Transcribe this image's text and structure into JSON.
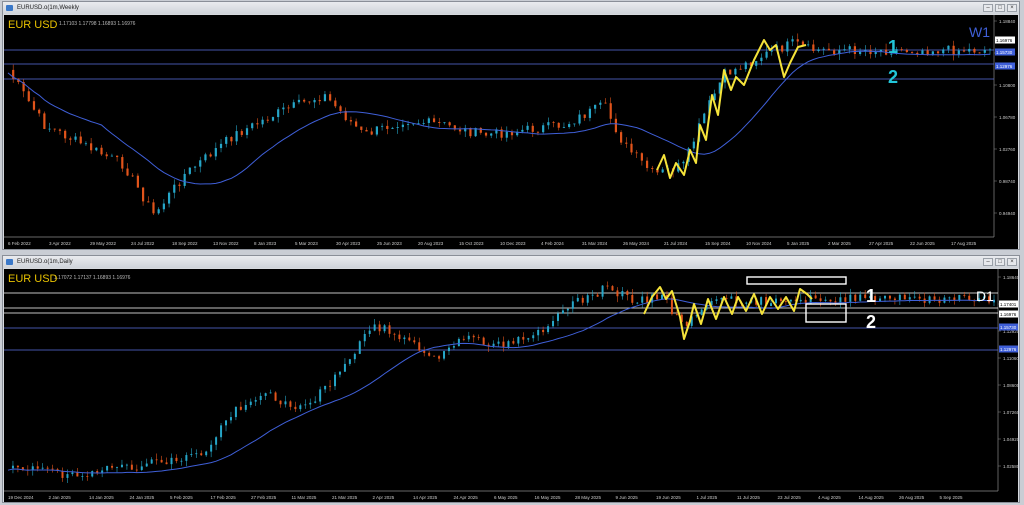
{
  "charts": [
    {
      "window_title": "EURUSD.o(1m,Weekly",
      "ohlc": "1.17103 1.17798 1.16893 1.16976",
      "symbol_label": "EUR USD",
      "timeframe": "W1",
      "marker_1": "1",
      "marker_2": "2",
      "price_ticks": [
        "1.18840",
        "1.14820",
        "1.10800",
        "1.06780",
        "1.02760",
        "0.98740",
        "0.94940"
      ],
      "price_boxes": [
        "1.16976",
        "1.15730",
        "1.12976"
      ],
      "date_ticks": [
        "6 Feb 2022",
        "3 Apr 2022",
        "29 May 2022",
        "24 Jul 2022",
        "18 Sep 2022",
        "13 Nov 2022",
        "8 Jan 2023",
        "5 Mar 2023",
        "30 Apr 2023",
        "25 Jun 2023",
        "20 Aug 2023",
        "15 Oct 2023",
        "10 Dec 2023",
        "4 Feb 2024",
        "31 Mar 2024",
        "26 May 2024",
        "21 Jul 2024",
        "15 Sep 2024",
        "10 Nov 2024",
        "5 Jan 2025",
        "2 Mar 2025",
        "27 Apr 2025",
        "22 Jun 2025",
        "17 Aug 2025"
      ],
      "colors": {
        "bull": "#26a6c8",
        "bear": "#e1541b",
        "ma": "#3f5fd8",
        "pattern": "#f5e33a",
        "hline": "#5b6fe0",
        "label": "#e8c200",
        "markers": "#22c6d9"
      }
    },
    {
      "window_title": "EURUSD.o(1m,Daily",
      "ohlc": "1.17072 1.17137 1.16893 1.16976",
      "symbol_label": "EUR USD",
      "timeframe": "D1",
      "marker_1": "1",
      "marker_2": "2",
      "price_ticks": [
        "1.18640",
        "1.15060",
        "1.12920",
        "1.11060",
        "1.08600",
        "1.07260",
        "1.04920",
        "1.02580"
      ],
      "price_boxes": [
        "1.17401",
        "1.16976",
        "1.15730",
        "1.12976"
      ],
      "date_ticks": [
        "19 Dec 2024",
        "2 Jan 2025",
        "14 Jan 2025",
        "24 Jan 2025",
        "5 Feb 2025",
        "17 Feb 2025",
        "27 Feb 2025",
        "11 Mar 2025",
        "21 Mar 2025",
        "2 Apr 2025",
        "14 Apr 2025",
        "24 Apr 2025",
        "6 May 2025",
        "16 May 2025",
        "28 May 2025",
        "9 Jun 2025",
        "19 Jun 2025",
        "1 Jul 2025",
        "11 Jul 2025",
        "23 Jul 2025",
        "4 Aug 2025",
        "14 Aug 2025",
        "26 Aug 2025",
        "5 Sep 2025"
      ],
      "colors": {
        "bull": "#26a6c8",
        "bear": "#e1541b",
        "ma": "#3f5fd8",
        "pattern": "#f5e33a",
        "hline": "#ffffff",
        "label": "#e8c200",
        "markers": "#ffffff"
      }
    }
  ]
}
